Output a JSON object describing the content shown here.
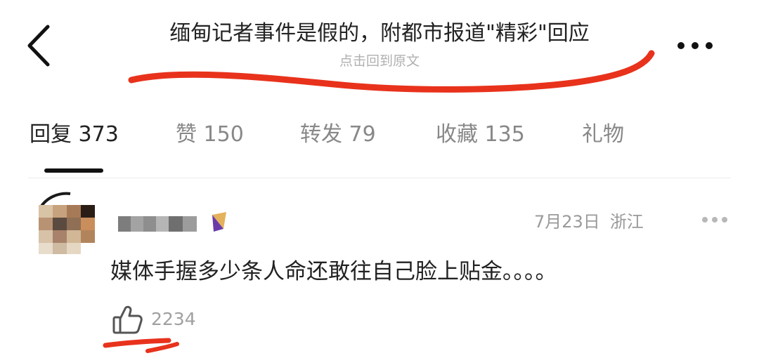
{
  "header": {
    "title": "缅甸记者事件是假的，附都市报道\"精彩\"回应",
    "subtitle": "点击回到原文",
    "back_icon": "chevron-left-icon",
    "more_icon": "more-horizontal-icon"
  },
  "tabs": [
    {
      "label": "回复",
      "count": "373",
      "active": true
    },
    {
      "label": "赞",
      "count": "150"
    },
    {
      "label": "转发",
      "count": "79"
    },
    {
      "label": "收藏",
      "count": "135"
    },
    {
      "label": "礼物",
      "count": ""
    }
  ],
  "comment": {
    "date": "7月23日",
    "location": "浙江",
    "text": "媒体手握多少条人命还敢往自己脸上贴金。。。。",
    "likes": "2234",
    "like_icon": "thumbs-up-icon",
    "more_icon": "more-horizontal-icon"
  },
  "colors": {
    "annotation_red": "#e8321c",
    "text_primary": "#222222",
    "text_secondary": "#9a9a9a"
  }
}
